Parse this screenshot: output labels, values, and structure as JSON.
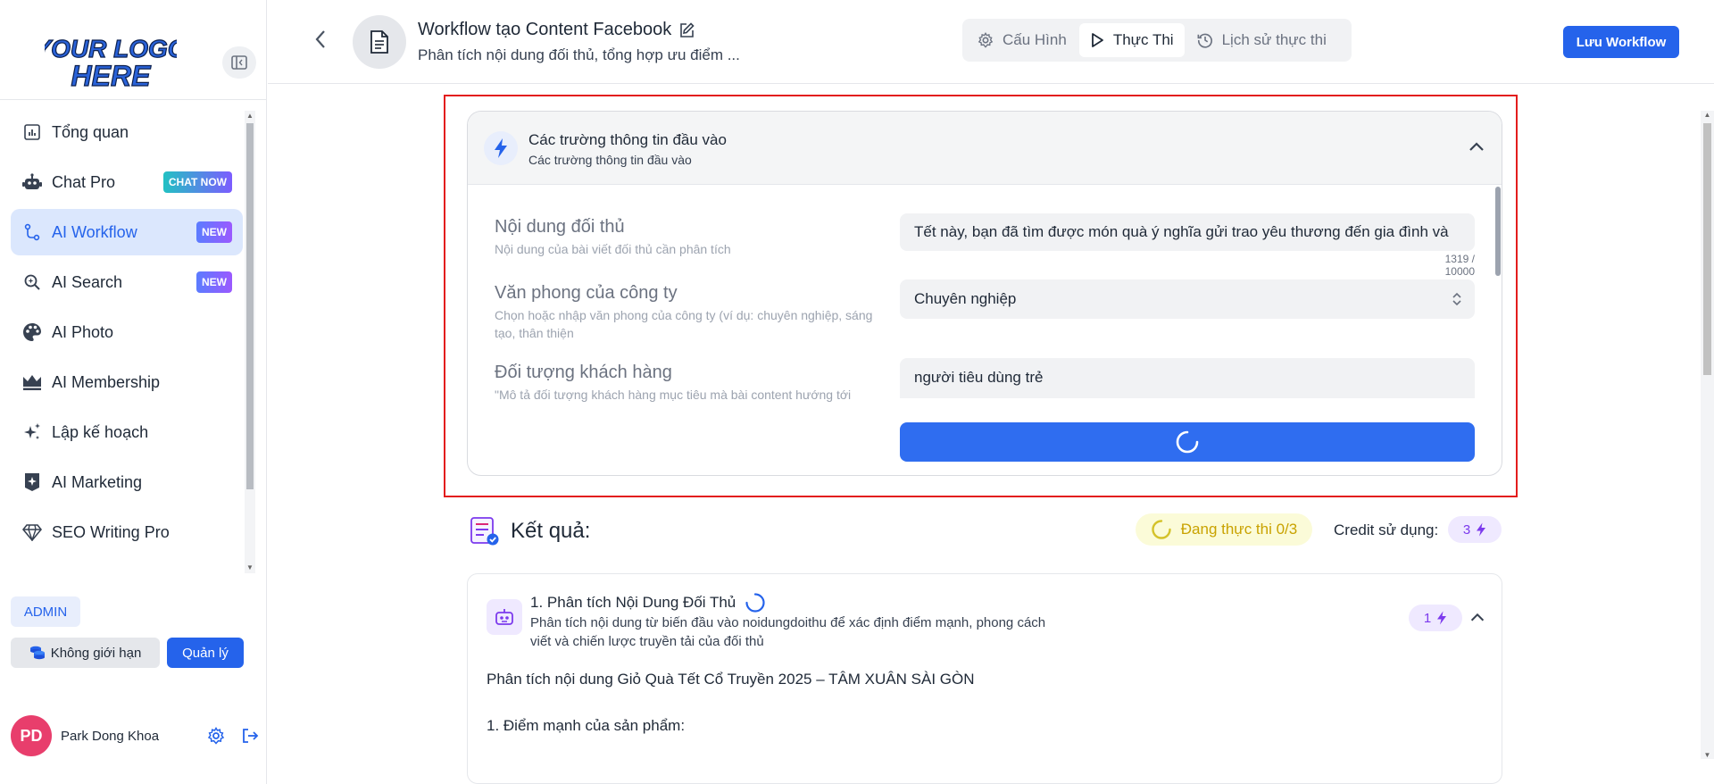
{
  "sidebar": {
    "logo_lines": [
      "YOUR LOGO",
      "HERE"
    ],
    "items": [
      {
        "label": "Tổng quan",
        "icon": "chart-bar-icon"
      },
      {
        "label": "Chat Pro",
        "icon": "robot-icon",
        "badge": "CHAT NOW"
      },
      {
        "label": "AI Workflow",
        "icon": "workflow-icon",
        "badge": "NEW",
        "active": true
      },
      {
        "label": "AI Search",
        "icon": "search-ai-icon",
        "badge": "NEW"
      },
      {
        "label": "AI Photo",
        "icon": "palette-icon"
      },
      {
        "label": "AI Membership",
        "icon": "crown-icon"
      },
      {
        "label": "Lập kế hoạch",
        "icon": "sparkles-icon"
      },
      {
        "label": "AI Marketing",
        "icon": "star-square-icon"
      },
      {
        "label": "SEO Writing Pro",
        "icon": "diamond-icon"
      }
    ],
    "role": "ADMIN",
    "limit_label": "Không giới hạn",
    "manage_label": "Quản lý",
    "user": {
      "initials": "PD",
      "name": "Park Dong Khoa"
    }
  },
  "header": {
    "title": "Workflow tạo Content Facebook",
    "subtitle": "Phân tích nội dung đối thủ, tổng hợp ưu điểm ...",
    "tabs": [
      {
        "label": "Cấu Hình",
        "icon": "gear-icon"
      },
      {
        "label": "Thực Thi",
        "icon": "play-icon",
        "active": true
      },
      {
        "label": "Lịch sử thực thi",
        "icon": "history-icon"
      }
    ],
    "save_label": "Lưu Workflow"
  },
  "input_card": {
    "title": "Các trường thông tin đầu vào",
    "subtitle": "Các trường thông tin đầu vào",
    "fields": [
      {
        "label": "Nội dung đối thủ",
        "help": "Nội dung của bài viết đối thủ cần phân tích",
        "value": "Tết này, bạn đã tìm được món quà ý nghĩa gửi trao yêu thương đến gia đình và",
        "counter": "1319 / 10000"
      },
      {
        "label": "Văn phong của công ty",
        "help": "Chọn hoặc nhập văn phong của công ty (ví dụ: chuyên nghiệp, sáng tạo, thân thiện",
        "value": "Chuyên nghiệp"
      },
      {
        "label": "Đối tượng khách hàng",
        "help": "\"Mô tả đối tượng khách hàng mục tiêu mà bài content hướng tới",
        "value": "người tiêu dùng trẻ"
      }
    ]
  },
  "result": {
    "title": "Kết quả:",
    "status": "Đang thực thi 0/3",
    "credit_label": "Credit sử dụng:",
    "credit_value": "3",
    "step": {
      "title": "1. Phân tích Nội Dung Đối Thủ",
      "desc": "Phân tích nội dung từ biến đầu vào noidungdoithu để xác định điểm mạnh, phong cách viết và chiến lược truyền tải của đối thủ",
      "credit": "1",
      "output_heading": "Phân tích nội dung Giỏ Quà Tết Cổ Truyền 2025 – TÂM XUÂN SÀI GÒN",
      "output_sub": "1. Điểm mạnh của sản phẩm:"
    }
  },
  "colors": {
    "accent": "#2563eb",
    "highlight": "#e31d1d",
    "status_text": "#c9a200",
    "credit": "#7c3aed"
  }
}
